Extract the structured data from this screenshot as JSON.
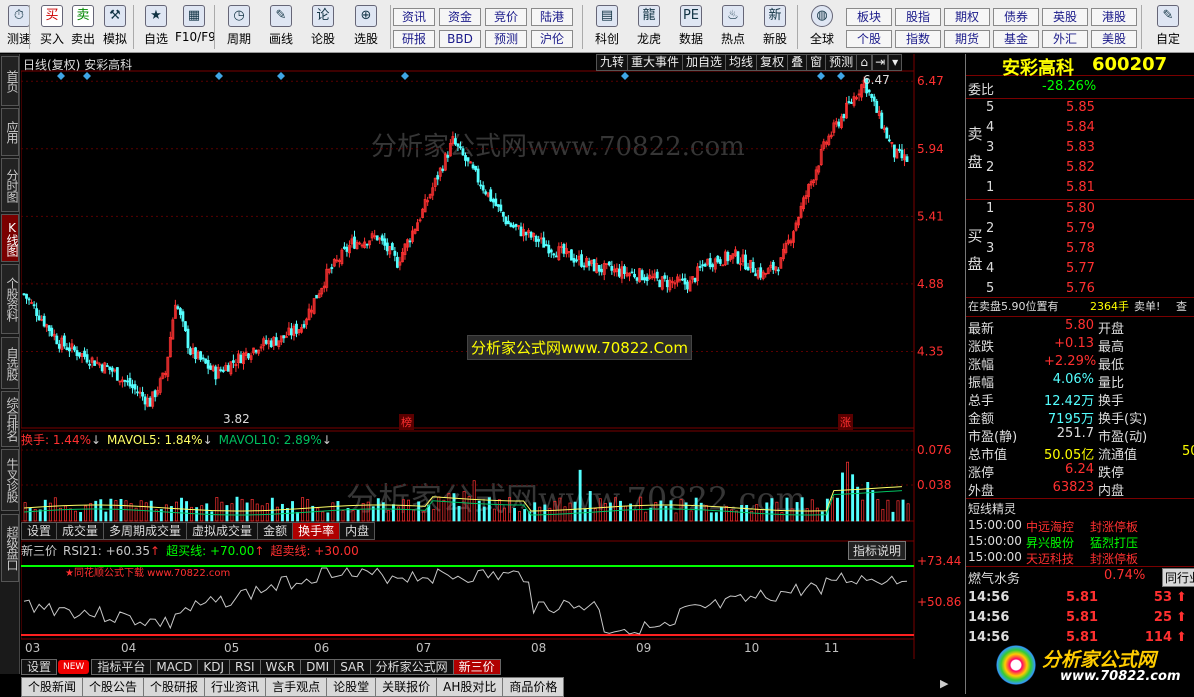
{
  "toolbar": {
    "left": [
      {
        "label": "测速",
        "icon": "clock-icon",
        "glyph": "⏱"
      },
      {
        "label": "买入",
        "icon": "buy-icon",
        "glyph": "买"
      },
      {
        "label": "卖出",
        "icon": "sell-icon",
        "glyph": "卖"
      },
      {
        "label": "模拟",
        "icon": "hammer-icon",
        "glyph": "⚒"
      },
      {
        "label": "自选",
        "icon": "star-icon",
        "glyph": "★"
      },
      {
        "label": "F10/F9",
        "icon": "grid-icon",
        "glyph": "▦"
      },
      {
        "label": "周期",
        "icon": "period-icon",
        "glyph": "◷"
      },
      {
        "label": "画线",
        "icon": "pen-icon",
        "glyph": "✎"
      },
      {
        "label": "论股",
        "icon": "comment-icon",
        "glyph": "论"
      },
      {
        "label": "选股",
        "icon": "magnify-icon",
        "glyph": "⊕"
      }
    ],
    "grid": [
      [
        "资讯",
        "资金",
        "竞价",
        "陆港"
      ],
      [
        "研报",
        "BBD",
        "预测",
        "沪伦"
      ]
    ],
    "mid": [
      {
        "label": "科创",
        "icon": "chart-icon",
        "glyph": "▤"
      },
      {
        "label": "龙虎",
        "icon": "dragon-icon",
        "glyph": "龍"
      },
      {
        "label": "数据",
        "icon": "pe-icon",
        "glyph": "PE"
      },
      {
        "label": "热点",
        "icon": "hot-icon",
        "glyph": "♨"
      },
      {
        "label": "新股",
        "icon": "ipo-icon",
        "glyph": "新"
      }
    ],
    "globe": {
      "label": "全球",
      "icon": "globe-icon",
      "glyph": "◍"
    },
    "grid2": [
      [
        "板块",
        "股指",
        "期权",
        "债券",
        "英股",
        "港股"
      ],
      [
        "个股",
        "指数",
        "期货",
        "基金",
        "外汇",
        "美股"
      ]
    ],
    "custom": {
      "label": "自定",
      "icon": "edit-icon",
      "glyph": "✎"
    }
  },
  "lefttabs": [
    "首页",
    "应用",
    "分时图",
    "K线图",
    "个股资料",
    "自选股",
    "综合排名",
    "牛叉诊股",
    "超级盘口"
  ],
  "chart": {
    "title": "日线(复权) 安彩高科",
    "top_buttons": [
      "九转",
      "重大事件",
      "加自选",
      "均线",
      "复权",
      "叠",
      "窗",
      "预测"
    ],
    "price_axis": [
      "6.47",
      "5.94",
      "5.41",
      "4.88",
      "4.35"
    ],
    "high_label": "6.47",
    "low_label": "3.82",
    "mark1": "榜",
    "mark2": "涨",
    "watermark": "分析家公式网www.70822.com",
    "center_tag": "分析家公式网www.70822.Com",
    "vol_header": {
      "t1": "换手: 1.44%",
      "t2": "MAVOL5: 1.84%",
      "t3": "MAVOL10: 2.89%"
    },
    "vol_axis": [
      "0.076",
      "0.038"
    ],
    "mid_tabs": [
      "设置",
      "成交量",
      "多周期成交量",
      "虚拟成交量",
      "金额",
      "换手率",
      "内盘"
    ],
    "ind_header": {
      "t1": "新三价",
      "t2": "RSI21: +60.35",
      "t3": "超买线: +70.00",
      "t4": "超卖线: +30.00"
    },
    "ind_button": "指标说明",
    "ind_axis": [
      "+73.44",
      "+50.86"
    ],
    "ind_note": "★同花顺公式下载 www.70822.com",
    "x_labels": [
      "03",
      "04",
      "05",
      "06",
      "07",
      "08",
      "09",
      "10",
      "11"
    ]
  },
  "quote": {
    "name": "安彩高科",
    "code": "600207",
    "webi_label": "委比",
    "webi": "-28.26%",
    "sell_label": "卖盘",
    "buy_label": "买盘",
    "sell": [
      [
        "5",
        "5.85"
      ],
      [
        "4",
        "5.84"
      ],
      [
        "3",
        "5.83"
      ],
      [
        "2",
        "5.82"
      ],
      [
        "1",
        "5.81"
      ]
    ],
    "buy": [
      [
        "1",
        "5.80"
      ],
      [
        "2",
        "5.79"
      ],
      [
        "3",
        "5.78"
      ],
      [
        "4",
        "5.77"
      ],
      [
        "5",
        "5.76"
      ]
    ],
    "notice": "在卖盘5.90位置有",
    "notice_qty": "2364手",
    "notice_tag": "卖单!",
    "notice_btn": "查",
    "stats": [
      [
        "最新",
        "5.80",
        "开盘"
      ],
      [
        "涨跌",
        "+0.13",
        "最高"
      ],
      [
        "涨幅",
        "+2.29%",
        "最低"
      ],
      [
        "振幅",
        "4.06%",
        "量比"
      ],
      [
        "总手",
        "12.42万",
        "换手"
      ],
      [
        "金额",
        "7195万",
        "换手(实)"
      ],
      [
        "市盈(静)",
        "251.7",
        "市盈(动)"
      ],
      [
        "总市值",
        "50.05亿",
        "流通值"
      ],
      [
        "涨停",
        "6.24",
        "跌停"
      ],
      [
        "外盘",
        "63823",
        "内盘"
      ]
    ],
    "stat_tail": "50",
    "short_title": "短线精灵",
    "short": [
      [
        "15:00:00",
        "中远海控",
        "封涨停板"
      ],
      [
        "15:00:00",
        "昇兴股份",
        "猛烈打压"
      ],
      [
        "15:00:00",
        "天迈科技",
        "封涨停板"
      ]
    ],
    "sector": "燃气水务",
    "sector_pct": "0.74%",
    "sector_btn": "同行业",
    "ticks": [
      [
        "14:56",
        "5.81",
        "53"
      ],
      [
        "14:56",
        "5.81",
        "25"
      ],
      [
        "14:56",
        "5.81",
        "114"
      ]
    ],
    "logo_text": "分析家公式网",
    "logo_url": "www.70822.com"
  },
  "bottom": {
    "row1": [
      "设置",
      "NEW",
      "指标平台",
      "MACD",
      "KDJ",
      "RSI",
      "W&R",
      "DMI",
      "SAR",
      "分析家公式网",
      "新三价"
    ],
    "row2": [
      "个股新闻",
      "个股公告",
      "个股研报",
      "行业资讯",
      "言手观点",
      "论股堂",
      "关联报价",
      "AH股对比",
      "商品价格"
    ]
  },
  "colors": {
    "up": "#ff3232",
    "down": "#54ffff",
    "accent": "#ffff00",
    "grid": "#7a0000"
  }
}
